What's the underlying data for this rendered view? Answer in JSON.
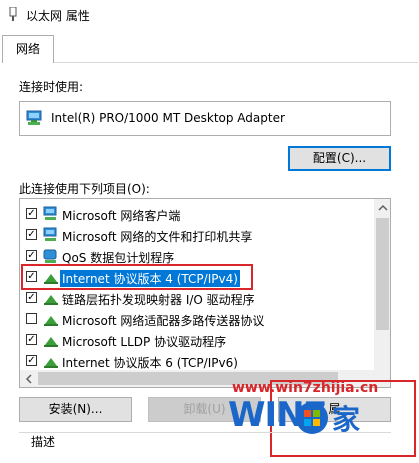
{
  "window": {
    "title": "以太网 属性"
  },
  "tabs": [
    {
      "label": "网络"
    }
  ],
  "connect_using": {
    "label": "连接时使用:",
    "adapter": "Intel(R) PRO/1000 MT Desktop Adapter",
    "configure_label": "配置(C)..."
  },
  "items_section": {
    "label": "此连接使用下列项目(O):",
    "items": [
      {
        "label": "Microsoft 网络客户端",
        "checked": true,
        "icon": "network-client-icon"
      },
      {
        "label": "Microsoft 网络的文件和打印机共享",
        "checked": true,
        "icon": "file-share-icon"
      },
      {
        "label": "QoS 数据包计划程序",
        "checked": true,
        "icon": "qos-icon"
      },
      {
        "label": "Internet 协议版本 4 (TCP/IPv4)",
        "checked": true,
        "icon": "protocol-icon",
        "selected": true
      },
      {
        "label": "链路层拓扑发现映射器 I/O 驱动程序",
        "checked": true,
        "icon": "protocol-icon"
      },
      {
        "label": "Microsoft 网络适配器多路传送器协议",
        "checked": false,
        "icon": "protocol-icon"
      },
      {
        "label": "Microsoft LLDP 协议驱动程序",
        "checked": true,
        "icon": "protocol-icon"
      },
      {
        "label": "Internet 协议版本 6 (TCP/IPv6)",
        "checked": true,
        "icon": "protocol-icon"
      }
    ]
  },
  "buttons": {
    "install": "安装(N)...",
    "uninstall": "卸载(U)",
    "properties": "属"
  },
  "description": {
    "label": "描述"
  },
  "watermark": {
    "url": "www.win7zhijia.cn",
    "brand": "WIN7",
    "han": "家"
  },
  "colors": {
    "accent": "#0078d7",
    "highlight_box": "#d8262b",
    "watermark_blue": "#1b66c9"
  }
}
